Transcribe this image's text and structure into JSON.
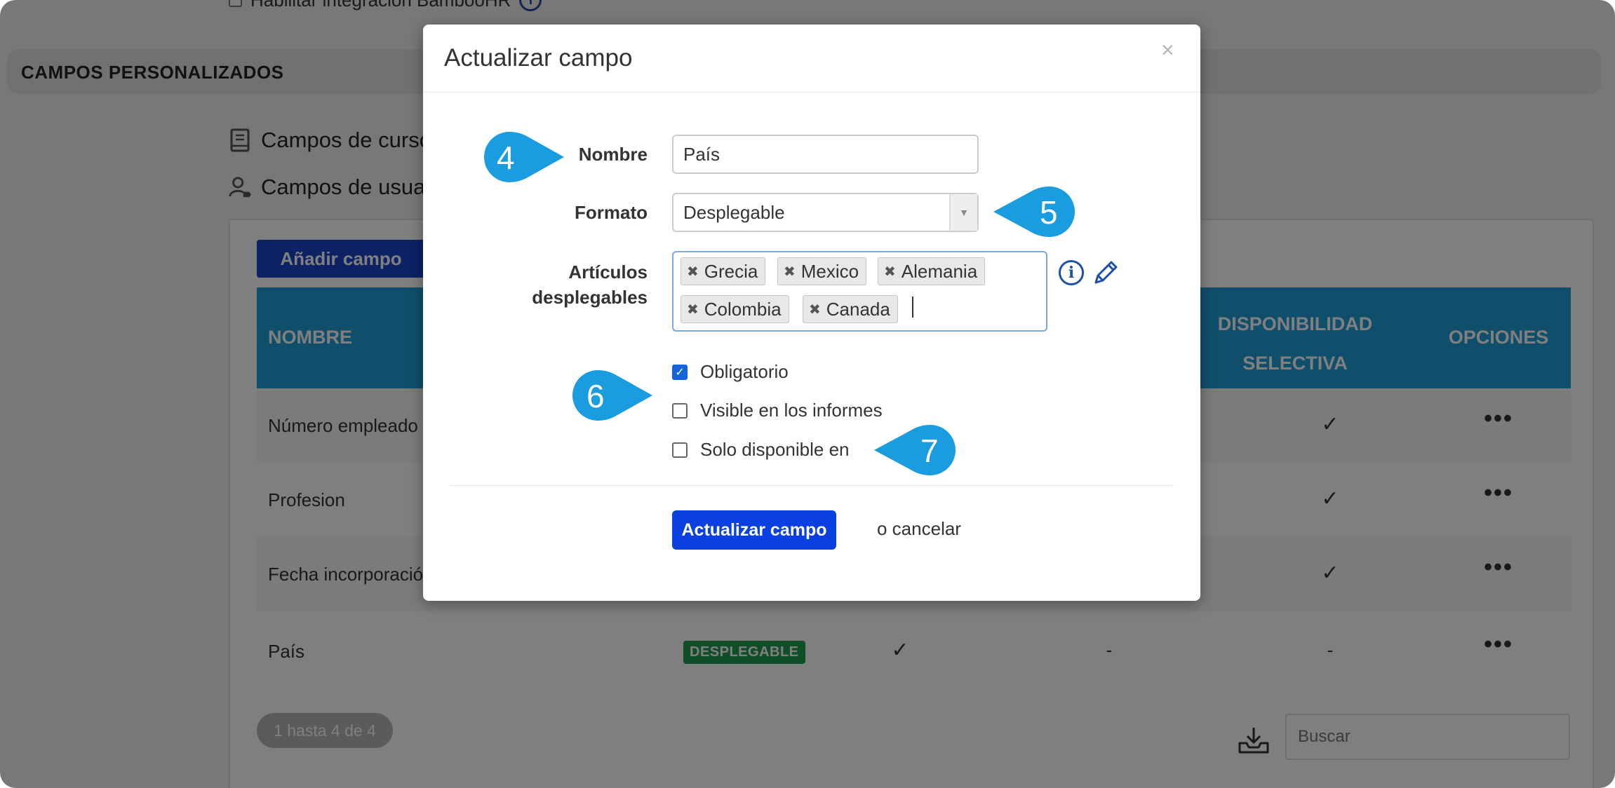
{
  "background": {
    "integration_checkbox_label": "Habilitar integración BambooHR",
    "section_title": "CAMPOS PERSONALIZADOS",
    "links": [
      {
        "label": "Campos de cursos"
      },
      {
        "label": "Campos de usuario"
      }
    ],
    "add_button": "Añadir campo",
    "table": {
      "headers": {
        "nombre": "NOMBRE",
        "disponibilidad_l1": "DISPONIBILIDAD",
        "disponibilidad_l2": "SELECTIVA",
        "opciones": "OPCIONES"
      },
      "rows": [
        {
          "name": "Número empleado",
          "disponibilidad": "✓",
          "options": "•••"
        },
        {
          "name": "Profesion",
          "disponibilidad": "✓",
          "options": "•••"
        },
        {
          "name": "Fecha incorporación",
          "disponibilidad": "✓",
          "options": "•••"
        },
        {
          "name": "País",
          "badge": "DESPLEGABLE",
          "col_check": "✓",
          "col_dash": "-",
          "disponibilidad": "-",
          "options": "•••"
        }
      ]
    },
    "pager": "1 hasta 4 de 4",
    "search_placeholder": "Buscar"
  },
  "modal": {
    "title": "Actualizar campo",
    "close": "×",
    "fields": {
      "nombre_label": "Nombre",
      "nombre_value": "País",
      "formato_label": "Formato",
      "formato_value": "Desplegable",
      "articulos_label_1": "Artículos",
      "articulos_label_2": "desplegables",
      "tags": [
        "Grecia",
        "Mexico",
        "Alemania",
        "Colombia",
        "Canada"
      ]
    },
    "checkboxes": [
      {
        "label": "Obligatorio",
        "checked": true
      },
      {
        "label": "Visible en los informes",
        "checked": false
      },
      {
        "label": "Solo disponible en",
        "checked": false
      }
    ],
    "submit": "Actualizar campo",
    "cancel": "o cancelar"
  },
  "callouts": [
    "4",
    "5",
    "6",
    "7"
  ],
  "colors": {
    "primary": "#0a3fe0",
    "table_header": "#1e9ed6",
    "callout": "#1a9ce0",
    "badge": "#1f9c4c"
  }
}
